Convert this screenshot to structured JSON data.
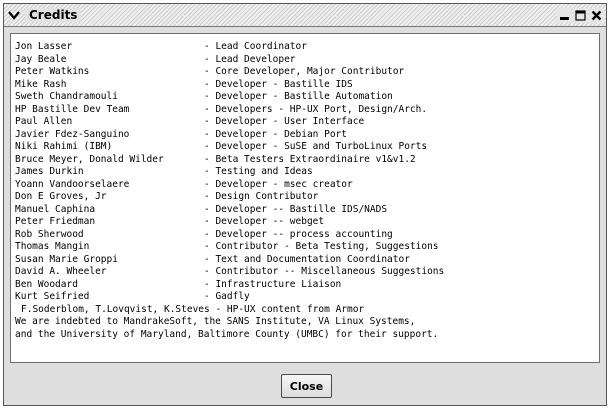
{
  "window": {
    "title": "Credits"
  },
  "credits": [
    {
      "name": "Jon Lasser",
      "role": "Lead Coordinator"
    },
    {
      "name": "Jay Beale",
      "role": "Lead Developer"
    },
    {
      "name": "Peter Watkins",
      "role": "Core Developer, Major Contributor"
    },
    {
      "name": "Mike Rash",
      "role": "Developer - Bastille IDS"
    },
    {
      "name": "Sweth Chandramouli",
      "role": "Developer - Bastille Automation"
    },
    {
      "name": "HP Bastille Dev Team",
      "role": "Developers - HP-UX Port, Design/Arch."
    },
    {
      "name": "Paul Allen",
      "role": "Developer - User Interface"
    },
    {
      "name": "Javier Fdez-Sanguino",
      "role": "Developer - Debian Port"
    },
    {
      "name": "Niki Rahimi (IBM)",
      "role": "Developer - SuSE and TurboLinux Ports"
    },
    {
      "name": "Bruce Meyer, Donald Wilder",
      "role": "Beta Testers Extraordinaire v1&v1.2"
    },
    {
      "name": "James Durkin",
      "role": "Testing and Ideas"
    },
    {
      "name": "Yoann Vandoorselaere",
      "role": "Developer - msec creator"
    },
    {
      "name": "Don E Groves, Jr",
      "role": "Design Contributor"
    },
    {
      "name": "Manuel Caphina",
      "role": "Developer -- Bastille IDS/NADS"
    },
    {
      "name": "Peter Friedman",
      "role": "Developer -- webget"
    },
    {
      "name": "Rob Sherwood",
      "role": "Developer -- process accounting"
    },
    {
      "name": "Thomas Mangin",
      "role": "Contributor - Beta Testing, Suggestions"
    },
    {
      "name": "Susan Marie Groppi",
      "role": "Text and Documentation Coordinator"
    },
    {
      "name": "David A. Wheeler",
      "role": "Contributor -- Miscellaneous Suggestions"
    },
    {
      "name": "Ben Woodard",
      "role": "Infrastructure Liaison"
    },
    {
      "name": "Kurt Seifried",
      "role": "Gadfly"
    }
  ],
  "trailer": {
    "armor_line": "F.Soderblom, T.Lovqvist, K.Steves - HP-UX content from Armor",
    "thanks_line_1": "We are indebted to MandrakeSoft, the SANS Institute, VA Linux Systems,",
    "thanks_line_2": "and the University of Maryland, Baltimore County (UMBC) for their support."
  },
  "buttons": {
    "close_label": "Close"
  }
}
